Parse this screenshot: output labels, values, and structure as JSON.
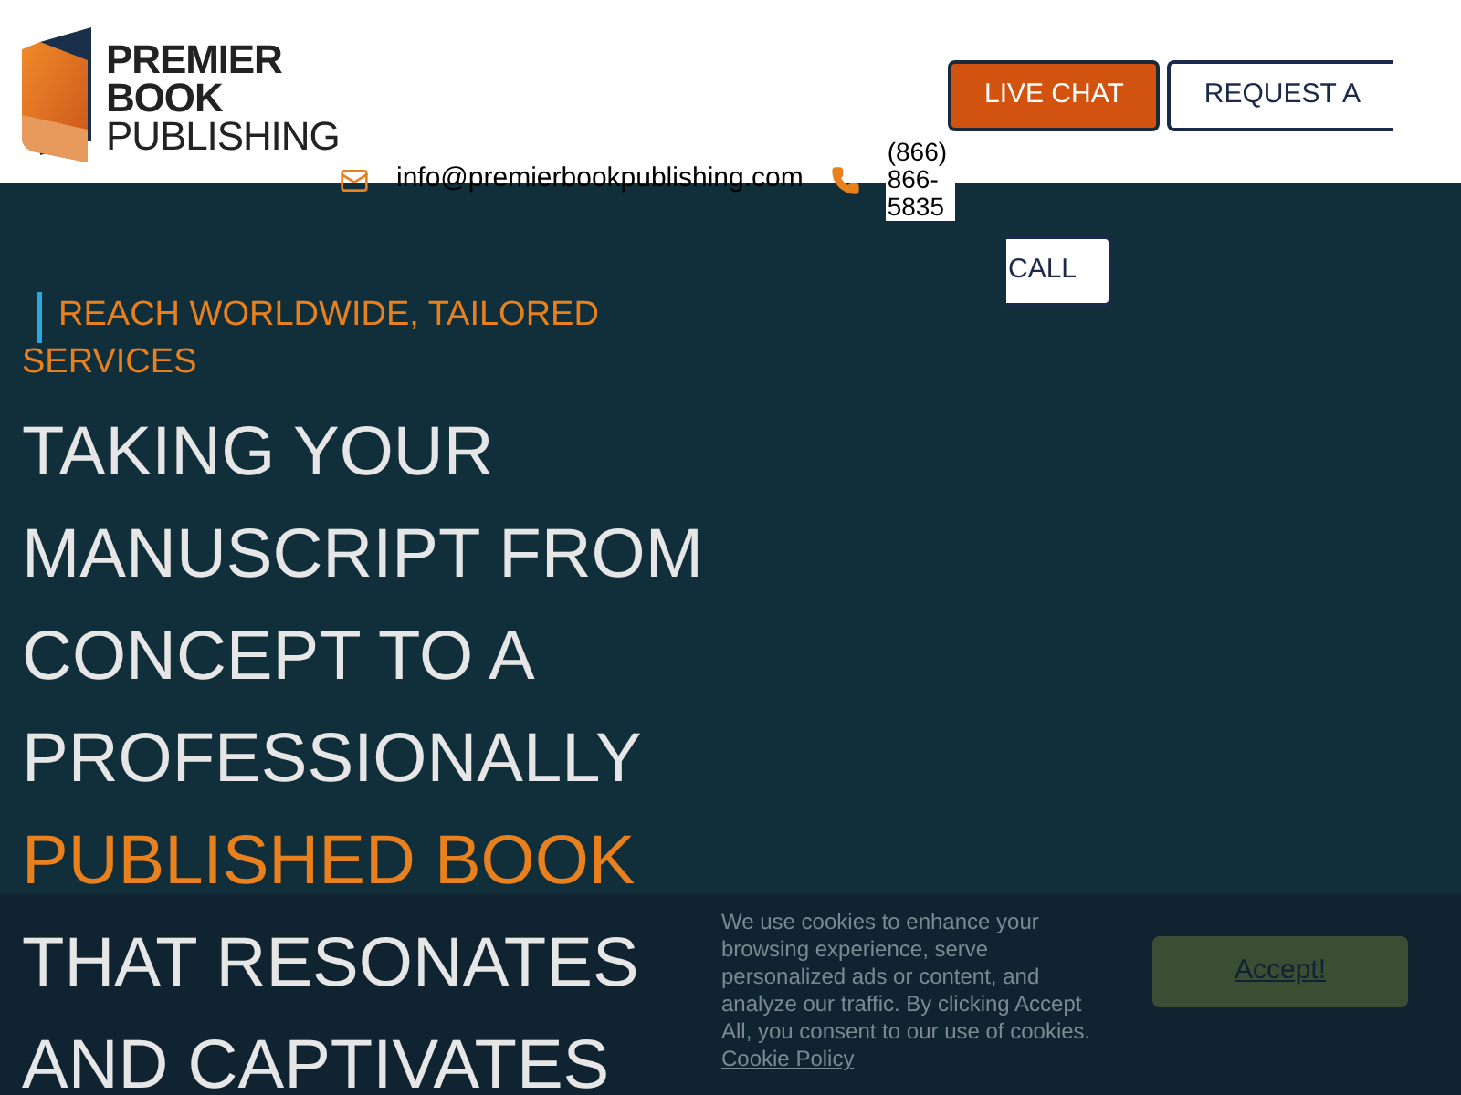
{
  "logo": {
    "line_1": "PREMIER",
    "line_2": "BOOK",
    "line_3": "PUBLISHING"
  },
  "header_buttons": [
    {
      "label": "LIVE CHAT",
      "kind": "primary"
    },
    {
      "label": "REQUEST A",
      "kind": "outline"
    }
  ],
  "contact": {
    "email": "info@premierbookpublishing.com",
    "phone": "(866) 866-5835"
  },
  "call_button": {
    "label": "CALL"
  },
  "hero": {
    "tagline": "REACH WORLDWIDE, TAILORED SERVICES",
    "headline": [
      [
        {
          "text": "TAKING YOUR",
          "accent": false
        }
      ],
      [
        {
          "text": "MANUSCRIPT FROM",
          "accent": false
        }
      ],
      [
        {
          "text": "CONCEPT TO A",
          "accent": false
        }
      ],
      [
        {
          "text": "PROFESSIONALLY",
          "accent": false
        }
      ],
      [
        {
          "text": "PUBLISHED BOOK",
          "accent": true
        }
      ],
      [
        {
          "text": "THAT RESONATES",
          "accent": false
        }
      ],
      [
        {
          "text": "AND CAPTIVATES",
          "accent": false
        }
      ]
    ]
  },
  "cookie_banner": {
    "text": "We use cookies to enhance your browsing experience, serve personalized ads or content, and analyze our traffic. By clicking Accept All, you consent to our use of cookies.",
    "link": "Cookie Policy",
    "button": "Accept!"
  }
}
